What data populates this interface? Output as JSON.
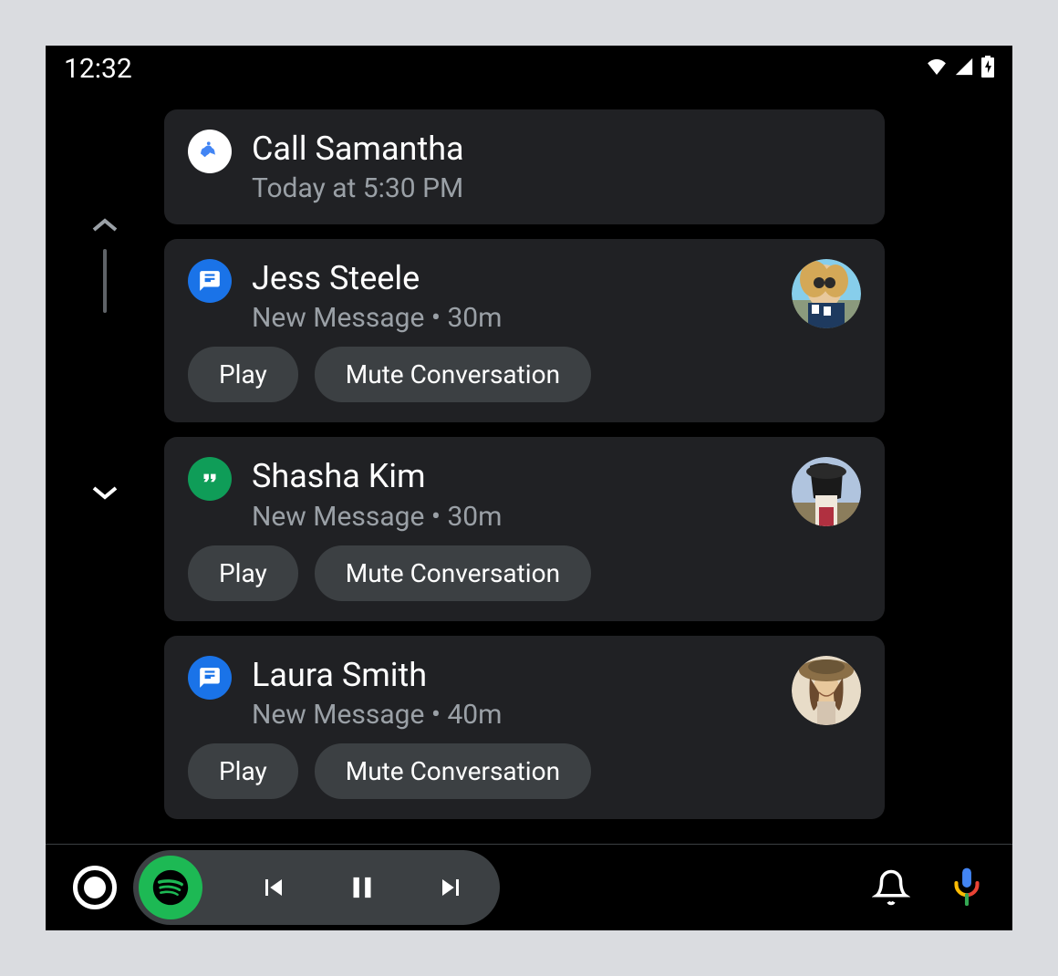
{
  "status": {
    "time": "12:32"
  },
  "notifications": [
    {
      "type": "reminder",
      "title": "Call Samantha",
      "subtitle": "Today at 5:30 PM",
      "icon": "reminder"
    },
    {
      "type": "message",
      "title": "Jess Steele",
      "subtitle": "New Message • 30m",
      "icon": "messages",
      "avatar": "jess",
      "play_label": "Play",
      "mute_label": "Mute Conversation"
    },
    {
      "type": "message",
      "title": "Shasha Kim",
      "subtitle": "New Message • 30m",
      "icon": "hangouts",
      "avatar": "shasha",
      "play_label": "Play",
      "mute_label": "Mute Conversation"
    },
    {
      "type": "message",
      "title": "Laura Smith",
      "subtitle": "New Message • 40m",
      "icon": "messages",
      "avatar": "laura",
      "play_label": "Play",
      "mute_label": "Mute Conversation"
    }
  ]
}
